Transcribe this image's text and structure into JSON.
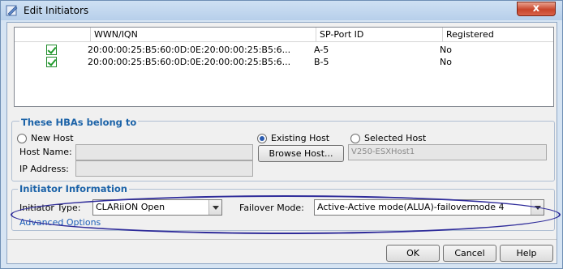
{
  "window": {
    "title": "Edit Initiators",
    "close_label": "x"
  },
  "table": {
    "columns": [
      "",
      "WWN/IQN",
      "SP-Port ID",
      "Registered"
    ],
    "rows": [
      {
        "checked": true,
        "wwn": "20:00:00:25:B5:60:0D:0E:20:00:00:25:B5:6...",
        "port": "A-5",
        "registered": "No"
      },
      {
        "checked": true,
        "wwn": "20:00:00:25:B5:60:0D:0E:20:00:00:25:B5:6...",
        "port": "B-5",
        "registered": "No"
      }
    ]
  },
  "hba_group": {
    "title": "These HBAs belong to",
    "new_host": {
      "label": "New Host",
      "selected": false
    },
    "host_name_label": "Host Name:",
    "host_name_value": "",
    "ip_label": "IP Address:",
    "ip_value": "",
    "existing_host": {
      "label": "Existing Host",
      "selected": true
    },
    "browse_label": "Browse Host...",
    "selected_host": {
      "label": "Selected Host",
      "selected": false
    },
    "selected_host_value": "V250-ESXHost1"
  },
  "initiator_group": {
    "title": "Initiator Information",
    "type_label": "Initiator Type:",
    "type_value": "CLARiiON Open",
    "failover_label": "Failover Mode:",
    "failover_value": "Active-Active mode(ALUA)-failovermode 4",
    "advanced_label": "Advanced Options"
  },
  "footer": {
    "ok_label": "OK",
    "cancel_label": "Cancel",
    "help_label": "Help"
  },
  "colors": {
    "annotation_ellipse": "#2f2c9a",
    "group_title": "#1c63a8",
    "check_green": "#1f9b2a"
  }
}
